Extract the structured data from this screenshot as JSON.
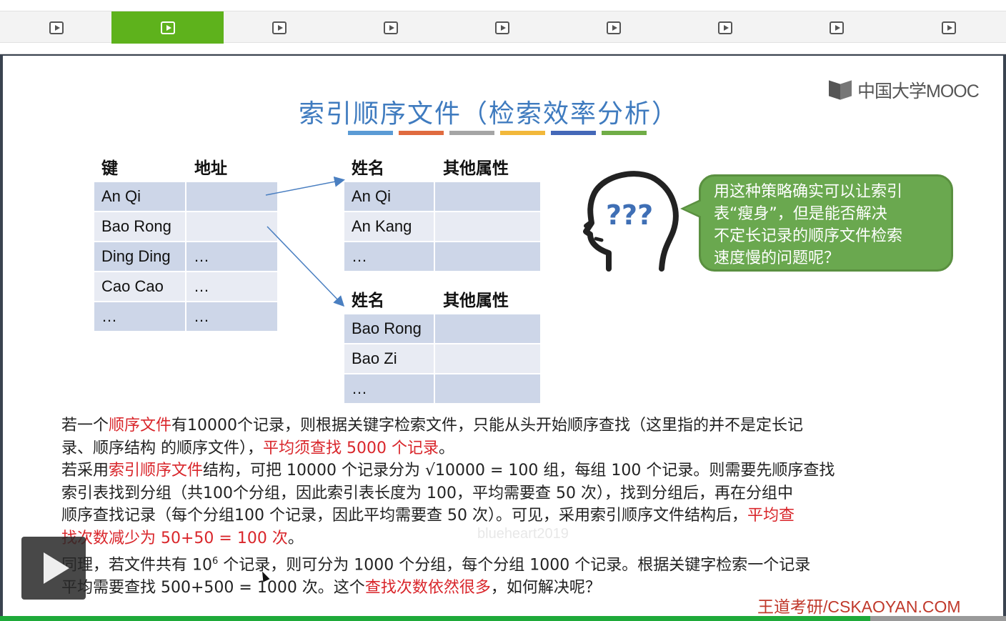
{
  "nav": {
    "items": [
      "",
      "",
      "",
      "",
      "",
      "",
      "",
      "",
      ""
    ],
    "active_index": 1,
    "icon": "play-icon",
    "active_color": "#5eb21c"
  },
  "slide": {
    "logo_text": "中国大学MOOC",
    "title": "索引顺序文件（检索效率分析）",
    "title_bar_colors": [
      "#5b9bd5",
      "#e06b3f",
      "#a5a5a5",
      "#f2b83a",
      "#4468b8",
      "#70ad47"
    ],
    "index_table": {
      "headers": [
        "键",
        "地址"
      ],
      "rows": [
        [
          "An Qi",
          ""
        ],
        [
          "Bao Rong",
          ""
        ],
        [
          "Ding Ding",
          "…"
        ],
        [
          "Cao Cao",
          "…"
        ],
        [
          "…",
          "…"
        ]
      ]
    },
    "group1": {
      "headers": [
        "姓名",
        "其他属性"
      ],
      "rows": [
        [
          "An Qi",
          ""
        ],
        [
          "An Kang",
          ""
        ],
        [
          "…",
          ""
        ]
      ]
    },
    "group2": {
      "headers": [
        "姓名",
        "其他属性"
      ],
      "rows": [
        [
          "Bao Rong",
          ""
        ],
        [
          "Bao Zi",
          ""
        ],
        [
          "…",
          ""
        ]
      ]
    },
    "bubble_lines": [
      "用这种策略确实可以让索引",
      "表“瘦身”，但是能否解决",
      "不定长记录的顺序文件检索",
      "速度慢的问题呢？"
    ],
    "para1": {
      "a": "若一个",
      "b": "顺序文件",
      "c": "有10000个记录，则根据关键字检索文件，只能从头开始顺序查找（这里指的并不是定长记",
      "d": "录、顺序结构 的顺序文件），",
      "e": "平均须查找 5000 个记录",
      "f": "。"
    },
    "para2": {
      "a": "若采用",
      "b": "索引顺序文件",
      "c": "结构，可把 10000 个记录分为 √10000 = 100  组，每组 100 个记录。则需要先顺序查找",
      "d": "索引表找到分组（共100个分组，因此索引表长度为 100，平均需要查 50 次），找到分组后，再在分组中",
      "e": "顺序查找记录（每个分组100 个记录，因此平均需要查 50 次）。可见，采用索引顺序文件结构后，",
      "f": "平均查",
      "g": "找次数减少为 50+50 = 100 次",
      "h": "。"
    },
    "para3": {
      "a": "同理，若文件共有 10",
      "sup": "6",
      "b": " 个记录，则可分为 1000 个分组，每个分组 1000 个记录。根据关键字检索一个记录",
      "c": "平均需要查找 500+500 = 1000 次。这个",
      "d": "查找次数依然很多",
      "e": "，如何解决呢？"
    },
    "watermark": "blueheart2019",
    "brand": "王道考研/CSKAOYAN.COM"
  },
  "player": {
    "play_icon": "play-icon",
    "progress": 0.865
  }
}
